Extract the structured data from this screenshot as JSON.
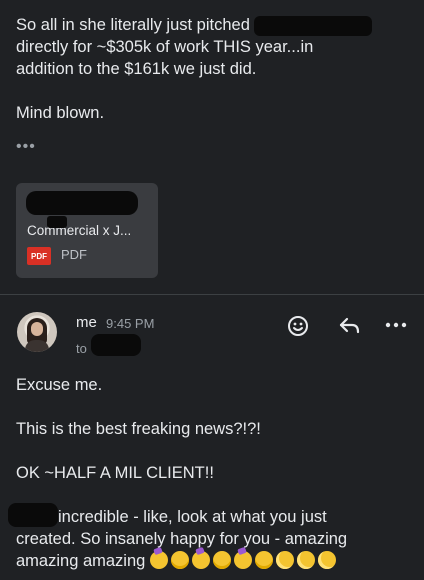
{
  "previous_message": {
    "line1": "So all in she literally just pitched",
    "line2": "directly for ~$305k of work THIS year...in",
    "line3": "addition to the $161k we just did.",
    "line4": "Mind blown.",
    "ellipsis": "•••"
  },
  "attachment": {
    "file_name": "Commercial x J...",
    "type_badge": "PDF",
    "type_label": "PDF"
  },
  "reply": {
    "sender": "me",
    "time": "9:45 PM",
    "to_label": "to",
    "lines": {
      "l1": "Excuse me.",
      "l2": "This is the best freaking news?!?!",
      "l3": "OK ~HALF A MIL CLIENT!!",
      "l4": "incredible - like, look at what you just",
      "l5": "created. So insanely happy for you - amazing",
      "l6": "amazing amazing"
    },
    "emojis": [
      "partying-face",
      "star-struck",
      "partying-face",
      "star-struck",
      "partying-face",
      "star-struck",
      "pleading-face",
      "pleading-face",
      "pleading-face"
    ]
  },
  "actions": {
    "emoji_icon": "add-reaction-icon",
    "reply_icon": "reply-arrow-icon",
    "more_icon": "more-horizontal-icon"
  },
  "colors": {
    "background": "#1f2124",
    "text": "#e8eaed",
    "muted": "#9aa0a6",
    "pdf_red": "#d93025"
  }
}
